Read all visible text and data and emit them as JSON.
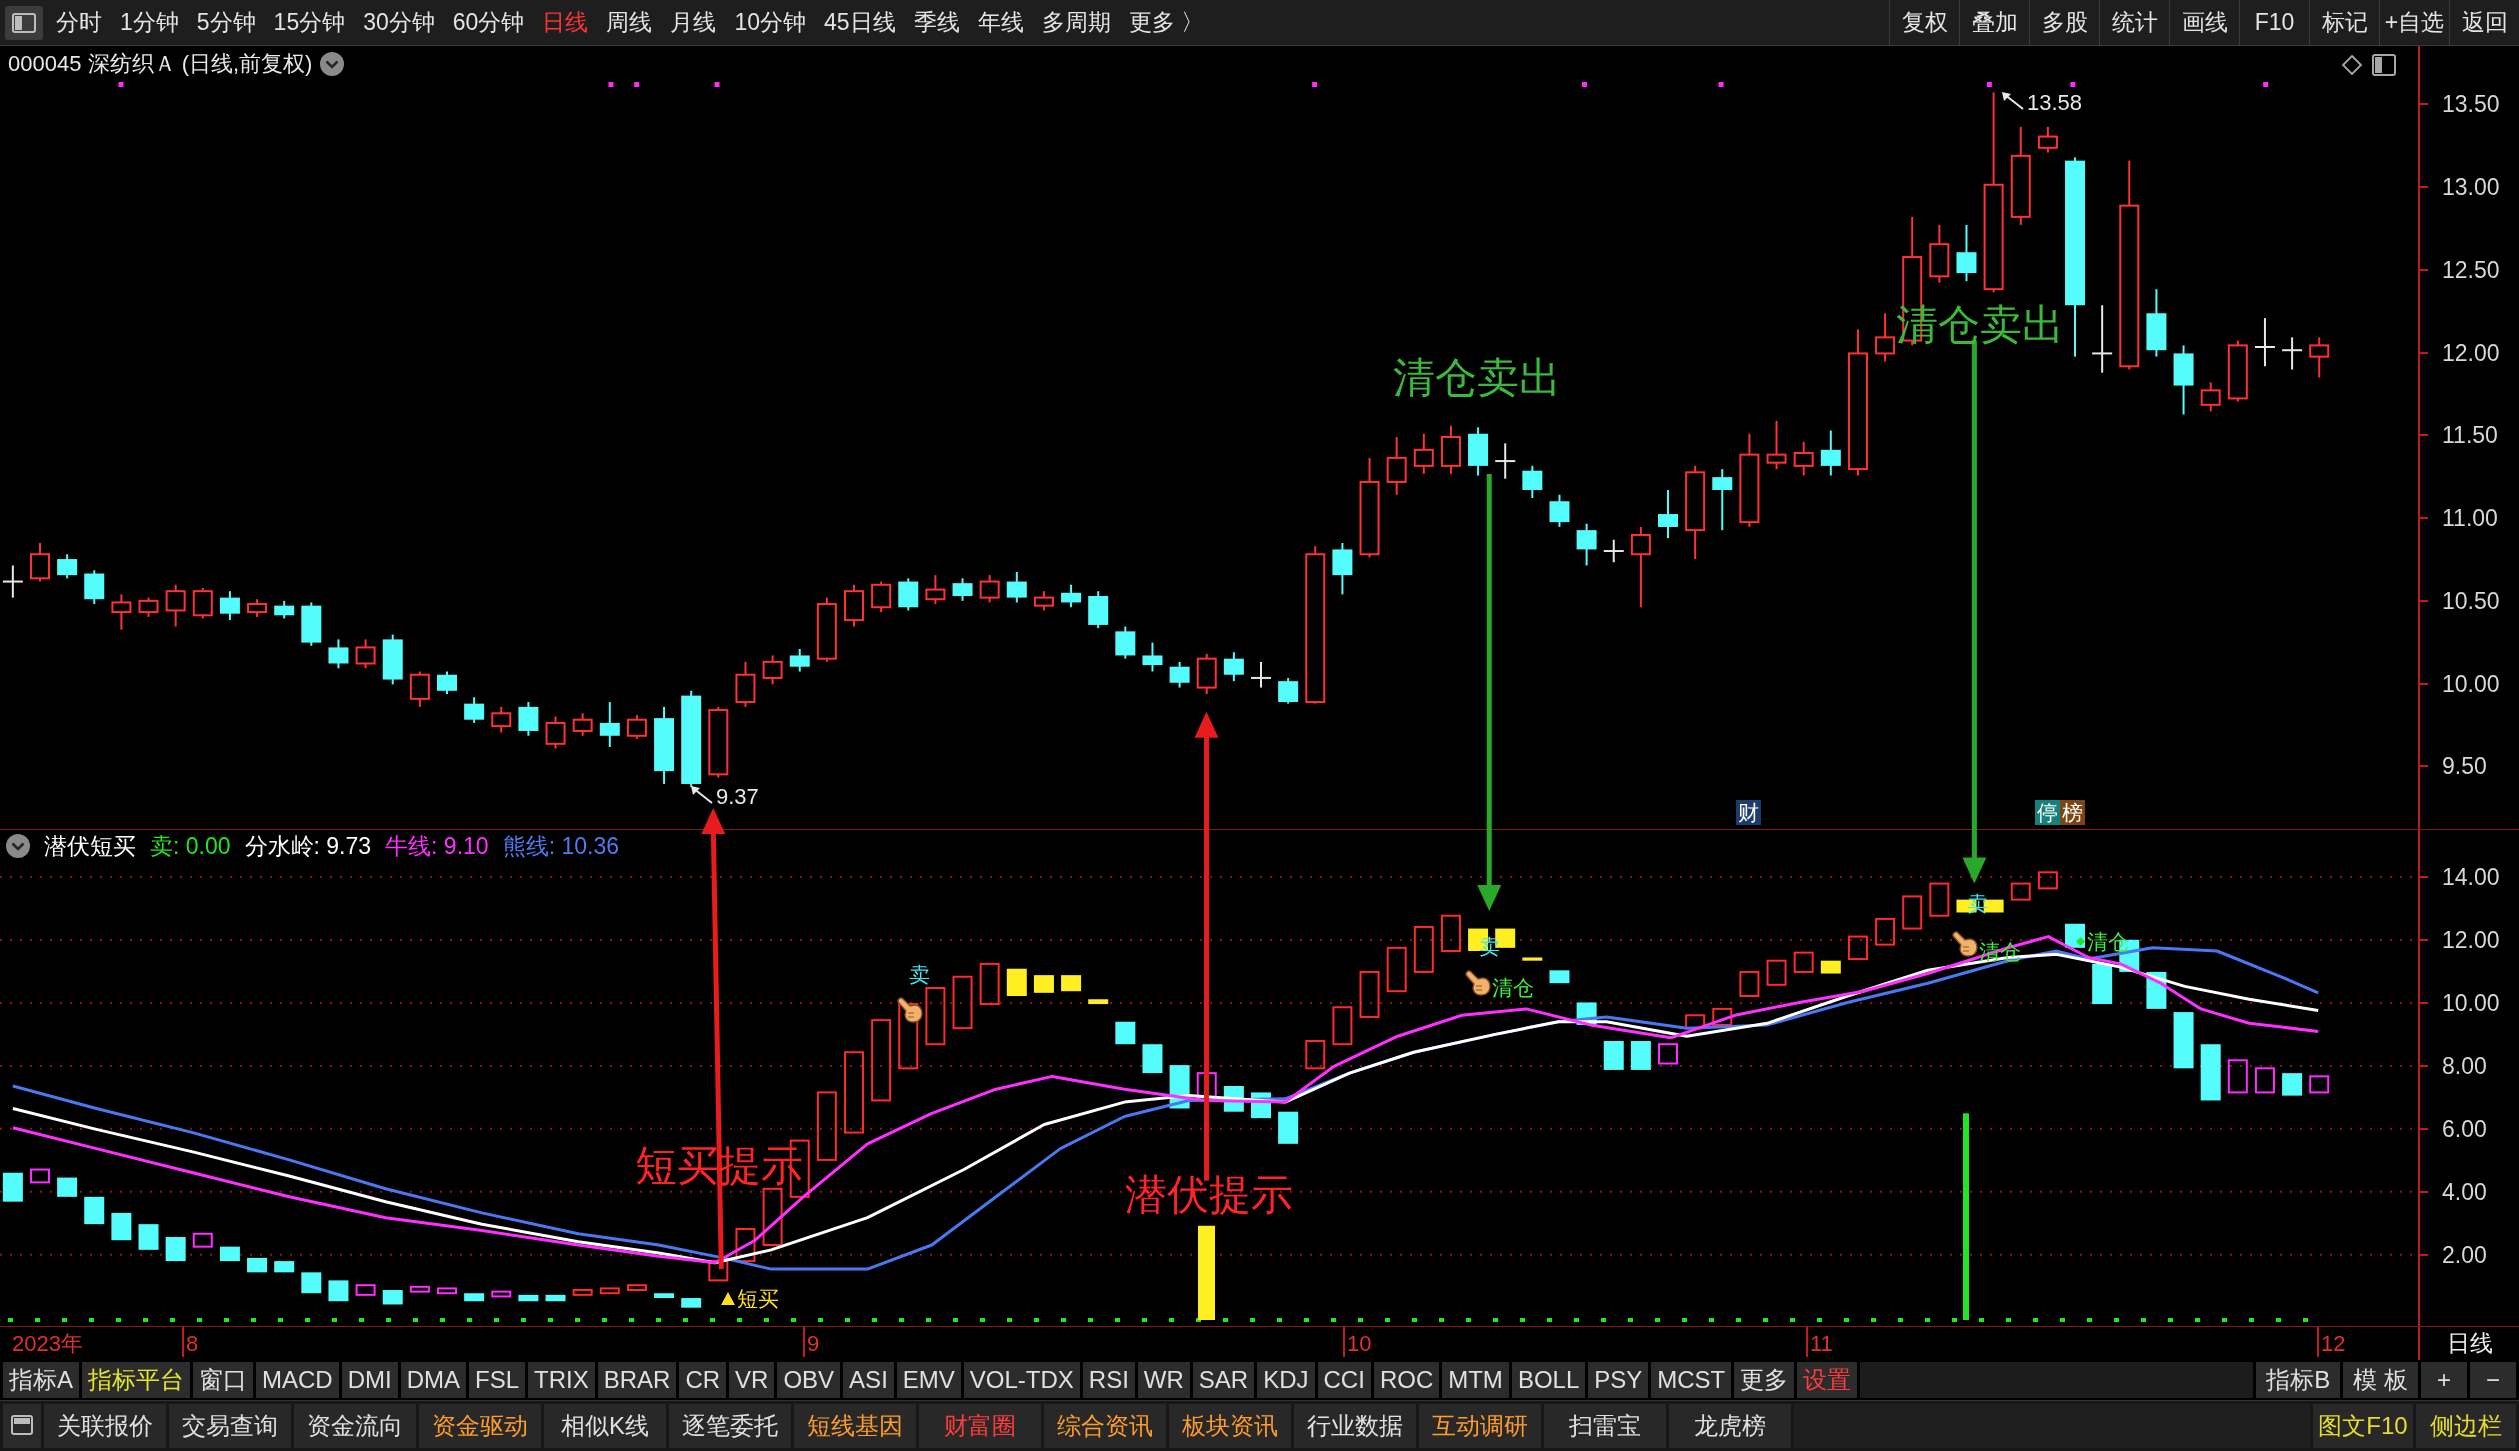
{
  "toolbar": {
    "periods": [
      {
        "label": "分时",
        "selected": false
      },
      {
        "label": "1分钟",
        "selected": false
      },
      {
        "label": "5分钟",
        "selected": false
      },
      {
        "label": "15分钟",
        "selected": false
      },
      {
        "label": "30分钟",
        "selected": false
      },
      {
        "label": "60分钟",
        "selected": false
      },
      {
        "label": "日线",
        "selected": true
      },
      {
        "label": "周线",
        "selected": false
      },
      {
        "label": "月线",
        "selected": false
      },
      {
        "label": "10分钟",
        "selected": false
      },
      {
        "label": "45日线",
        "selected": false
      },
      {
        "label": "季线",
        "selected": false
      },
      {
        "label": "年线",
        "selected": false
      },
      {
        "label": "多周期",
        "selected": false
      }
    ],
    "more": "更多 〉",
    "actions": [
      "复权",
      "叠加",
      "多股",
      "统计",
      "画线",
      "F10",
      "标记",
      "+自选",
      "返回"
    ]
  },
  "main_chart": {
    "title": "000045 深纺织Ａ (日线,前复权)",
    "high_label": "13.58",
    "low_label": "9.37",
    "event_marks": [
      {
        "text": "财",
        "color": "#1b3c6c"
      },
      {
        "text": "停",
        "color": "#17807c"
      },
      {
        "text": "榜",
        "color": "#7b4514"
      }
    ],
    "axis_labels": [
      "13.50",
      "13.00",
      "12.50",
      "12.00",
      "11.50",
      "11.00",
      "10.50",
      "10.00",
      "9.50"
    ]
  },
  "annotations": [
    {
      "text": "清仓卖出",
      "color": "#3cb83c"
    },
    {
      "text": "清仓卖出",
      "color": "#3cb83c"
    },
    {
      "text": "短买提示",
      "color": "#ff2424"
    },
    {
      "text": "潜伏提示",
      "color": "#ff2424"
    }
  ],
  "indicator": {
    "name": "潜伏短买",
    "values": [
      {
        "text": "卖: 0.00",
        "color": "#22e622"
      },
      {
        "text": "分水岭: 9.73",
        "color": "#ffffff"
      },
      {
        "text": "牛线: 9.10",
        "color": "#ff30ff"
      },
      {
        "text": "熊线: 10.36",
        "color": "#4c7cf0"
      }
    ],
    "signals": [
      {
        "kind": "buy",
        "text": "短买"
      },
      {
        "kind": "sell",
        "text": "卖"
      },
      {
        "kind": "sell",
        "text": "卖"
      },
      {
        "kind": "clear",
        "text": "清仓"
      },
      {
        "kind": "sell",
        "text": "卖"
      },
      {
        "kind": "clear",
        "text": "清仓"
      },
      {
        "kind": "clear",
        "text": "清仓"
      }
    ],
    "axis_labels": [
      "14.00",
      "12.00",
      "10.00",
      "8.00",
      "6.00",
      "4.00",
      "2.00"
    ]
  },
  "date_axis": {
    "labels": [
      "2023年",
      "8",
      "9",
      "10",
      "11",
      "12"
    ],
    "period": "日线"
  },
  "indicator_tabs": {
    "left": [
      {
        "label": "指标A",
        "kind": "plain"
      },
      {
        "label": "指标平台",
        "kind": "highlight"
      },
      {
        "label": "窗口",
        "kind": "plain"
      },
      {
        "label": "MACD",
        "kind": "plain"
      },
      {
        "label": "DMI",
        "kind": "plain"
      },
      {
        "label": "DMA",
        "kind": "plain"
      },
      {
        "label": "FSL",
        "kind": "plain"
      },
      {
        "label": "TRIX",
        "kind": "plain"
      },
      {
        "label": "BRAR",
        "kind": "plain"
      },
      {
        "label": "CR",
        "kind": "plain"
      },
      {
        "label": "VR",
        "kind": "plain"
      },
      {
        "label": "OBV",
        "kind": "plain"
      },
      {
        "label": "ASI",
        "kind": "plain"
      },
      {
        "label": "EMV",
        "kind": "plain"
      },
      {
        "label": "VOL-TDX",
        "kind": "plain"
      },
      {
        "label": "RSI",
        "kind": "plain"
      },
      {
        "label": "WR",
        "kind": "plain"
      },
      {
        "label": "SAR",
        "kind": "plain"
      },
      {
        "label": "KDJ",
        "kind": "plain"
      },
      {
        "label": "CCI",
        "kind": "plain"
      },
      {
        "label": "ROC",
        "kind": "plain"
      },
      {
        "label": "MTM",
        "kind": "plain"
      },
      {
        "label": "BOLL",
        "kind": "plain"
      },
      {
        "label": "PSY",
        "kind": "plain"
      },
      {
        "label": "MCST",
        "kind": "plain"
      },
      {
        "label": "更多",
        "kind": "plain"
      },
      {
        "label": "设置",
        "kind": "alert"
      }
    ],
    "right": [
      "指标B",
      "模 板",
      "+",
      "−"
    ]
  },
  "bottom_bar": {
    "items": [
      {
        "label": "关联报价",
        "color": "#e0e0e0"
      },
      {
        "label": "交易查询",
        "color": "#e0e0e0"
      },
      {
        "label": "资金流向",
        "color": "#e0e0e0"
      },
      {
        "label": "资金驱动",
        "color": "#ff9c2a"
      },
      {
        "label": "相似K线",
        "color": "#e0e0e0"
      },
      {
        "label": "逐笔委托",
        "color": "#e0e0e0"
      },
      {
        "label": "短线基因",
        "color": "#ff9c2a"
      },
      {
        "label": "财富圈",
        "color": "#ff3c3c"
      },
      {
        "label": "综合资讯",
        "color": "#ff9c2a"
      },
      {
        "label": "板块资讯",
        "color": "#ff9c2a"
      },
      {
        "label": "行业数据",
        "color": "#e0e0e0"
      },
      {
        "label": "互动调研",
        "color": "#ff9c2a"
      },
      {
        "label": "扫雷宝",
        "color": "#e0e0e0"
      },
      {
        "label": "龙虎榜",
        "color": "#e0e0e0"
      }
    ],
    "right": [
      {
        "label": "图文F10",
        "color": "#e6dc2a"
      },
      {
        "label": "侧边栏",
        "color": "#e6dc2a"
      }
    ]
  }
}
